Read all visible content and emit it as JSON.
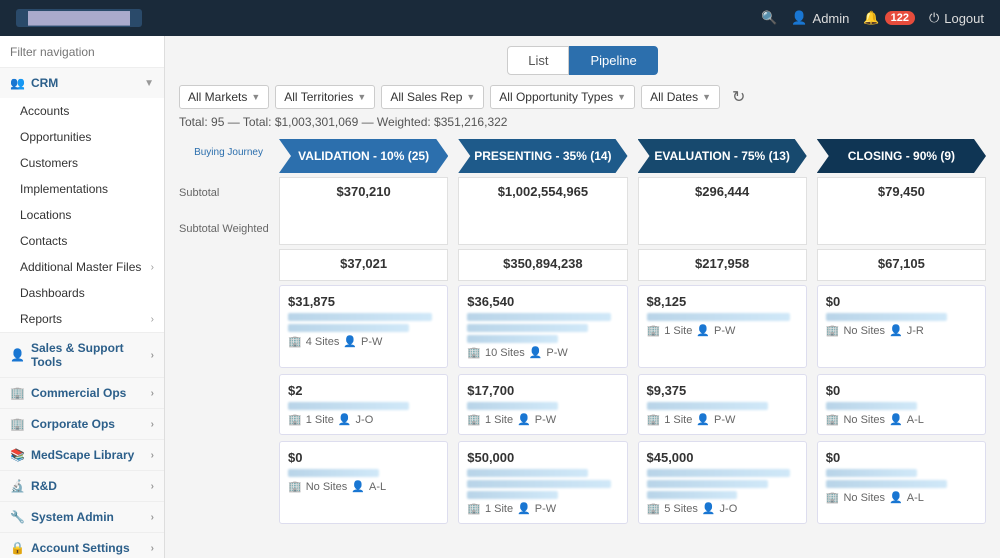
{
  "brand": "████████████",
  "topNav": {
    "searchLabel": "search",
    "adminLabel": "Admin",
    "notificationsCount": "122",
    "logoutLabel": "Logout"
  },
  "sidebar": {
    "filterPlaceholder": "Filter navigation",
    "collapseIcon": "«",
    "sections": [
      {
        "id": "crm",
        "label": "CRM",
        "icon": "👥",
        "expanded": true,
        "items": [
          {
            "label": "Accounts",
            "active": false
          },
          {
            "label": "Opportunities",
            "active": false
          },
          {
            "label": "Customers",
            "active": false
          },
          {
            "label": "Implementations",
            "active": false
          },
          {
            "label": "Locations",
            "active": false
          },
          {
            "label": "Contacts",
            "active": false
          },
          {
            "label": "Additional Master Files",
            "hasArrow": true,
            "active": false
          },
          {
            "label": "Dashboards",
            "active": false
          },
          {
            "label": "Reports",
            "hasArrow": true,
            "active": false
          }
        ]
      },
      {
        "id": "sales-support",
        "label": "Sales & Support Tools",
        "icon": "👤",
        "expanded": false,
        "items": []
      },
      {
        "id": "commercial-ops",
        "label": "Commercial Ops",
        "icon": "🏢",
        "expanded": false,
        "items": []
      },
      {
        "id": "corporate-ops",
        "label": "Corporate Ops",
        "icon": "🏢",
        "expanded": false,
        "items": []
      },
      {
        "id": "medscape",
        "label": "MedScape Library",
        "icon": "📚",
        "expanded": false,
        "items": []
      },
      {
        "id": "rd",
        "label": "R&D",
        "icon": "🔬",
        "expanded": false,
        "items": []
      },
      {
        "id": "system-admin",
        "label": "System Admin",
        "icon": "🔧",
        "expanded": false,
        "items": []
      },
      {
        "id": "account-settings",
        "label": "Account Settings",
        "icon": "🔒",
        "expanded": false,
        "items": []
      }
    ]
  },
  "viewToggle": {
    "listLabel": "List",
    "pipelineLabel": "Pipeline",
    "activeView": "Pipeline"
  },
  "filters": {
    "marketsLabel": "All Markets",
    "territoriesLabel": "All Territories",
    "salesRepLabel": "All Sales Rep",
    "opportunityTypesLabel": "All Opportunity Types",
    "datesLabel": "All Dates"
  },
  "summary": {
    "text": "Total: 95 — Total: $1,003,301,069 — Weighted: $351,216,322"
  },
  "buyingJourneyLabel": "Buying Journey",
  "columns": [
    {
      "id": "validation",
      "label": "VALIDATION - 10% (25)",
      "style": "validation",
      "subtotal": "$370,210",
      "subtotalWeighted": "$37,021"
    },
    {
      "id": "presenting",
      "label": "PRESENTING - 35% (14)",
      "style": "presenting",
      "subtotal": "$1,002,554,965",
      "subtotalWeighted": "$350,894,238"
    },
    {
      "id": "evaluation",
      "label": "EVALUATION - 75% (13)",
      "style": "evaluation",
      "subtotal": "$296,444",
      "subtotalWeighted": "$217,958"
    },
    {
      "id": "closing",
      "label": "CLOSING - 90% (9)",
      "style": "closing",
      "subtotal": "$79,450",
      "subtotalWeighted": "$67,105"
    }
  ],
  "subtotalLabel": "Subtotal",
  "subtotalWeightedLabel": "Subtotal Weighted",
  "cards": [
    [
      {
        "amount": "$31,875",
        "sites": "4 Sites",
        "rep": "P-W",
        "bars": [
          "long",
          "medium",
          "short"
        ]
      },
      {
        "amount": "$2",
        "sites": "1 Site",
        "rep": "J-O",
        "bars": [
          "medium",
          "short"
        ]
      },
      {
        "amount": "$0",
        "sites": "No Sites",
        "rep": "A-L",
        "bars": [
          "short"
        ]
      }
    ],
    [
      {
        "amount": "$36,540",
        "sites": "10 Sites",
        "rep": "P-W",
        "bars": [
          "long",
          "medium",
          "medium",
          "short"
        ]
      },
      {
        "amount": "$17,700",
        "sites": "1 Site",
        "rep": "P-W",
        "bars": [
          "medium",
          "short"
        ]
      },
      {
        "amount": "$50,000",
        "sites": "1 Site",
        "rep": "P-W",
        "bars": [
          "medium",
          "long",
          "short"
        ]
      }
    ],
    [
      {
        "amount": "$8,125",
        "sites": "1 Site",
        "rep": "P-W",
        "bars": [
          "long",
          "short"
        ]
      },
      {
        "amount": "$9,375",
        "sites": "1 Site",
        "rep": "P-W",
        "bars": [
          "medium",
          "short"
        ]
      },
      {
        "amount": "$45,000",
        "sites": "5 Sites",
        "rep": "J-O",
        "bars": [
          "long",
          "medium",
          "short",
          "medium"
        ]
      }
    ],
    [
      {
        "amount": "$0",
        "sites": "No Sites",
        "rep": "J-R",
        "bars": [
          "long",
          "short"
        ]
      },
      {
        "amount": "$0",
        "sites": "No Sites",
        "rep": "A-L",
        "bars": [
          "medium"
        ]
      },
      {
        "amount": "$0",
        "sites": "No Sites",
        "rep": "A-L",
        "bars": [
          "short",
          "medium"
        ]
      }
    ]
  ]
}
